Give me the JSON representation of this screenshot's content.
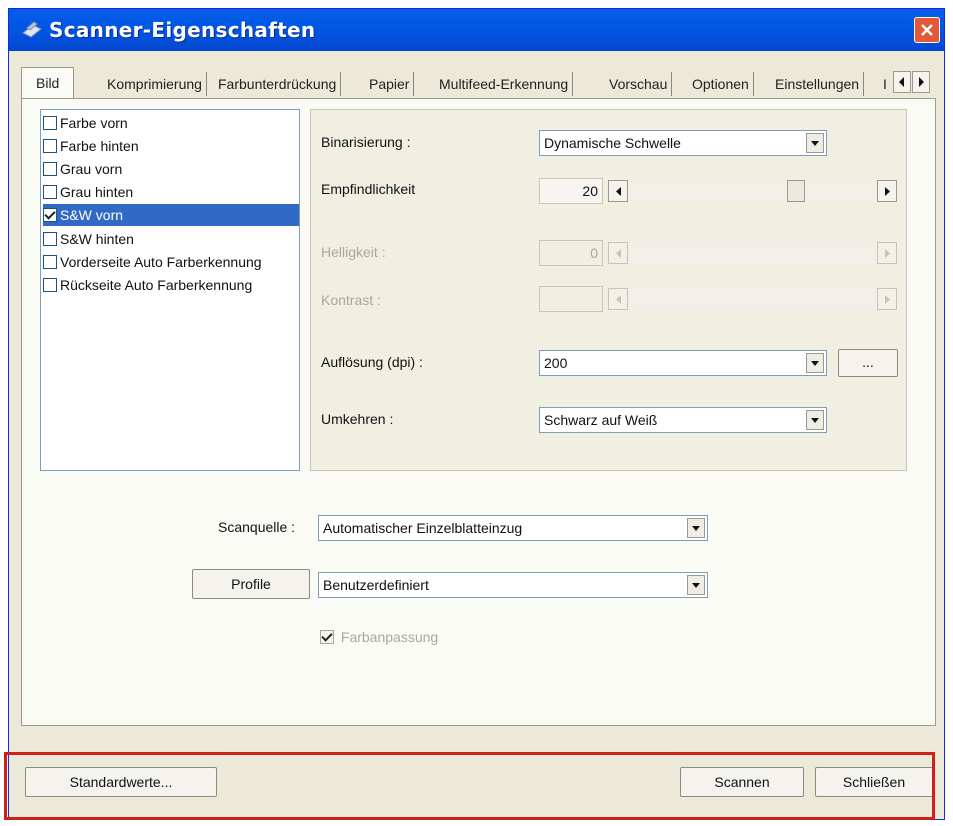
{
  "window": {
    "title": "Scanner-Eigenschaften"
  },
  "tabs": [
    {
      "label": "Bild"
    },
    {
      "label": "Komprimierung"
    },
    {
      "label": "Farbunterdrückung"
    },
    {
      "label": "Papier"
    },
    {
      "label": "Multifeed-Erkennung"
    },
    {
      "label": "Vorschau"
    },
    {
      "label": "Optionen"
    },
    {
      "label": "Einstellungen"
    },
    {
      "label": "I"
    }
  ],
  "image_list": [
    {
      "label": "Farbe vorn",
      "checked": false
    },
    {
      "label": "Farbe hinten",
      "checked": false
    },
    {
      "label": "Grau vorn",
      "checked": false
    },
    {
      "label": "Grau hinten",
      "checked": false
    },
    {
      "label": "S&W vorn",
      "checked": true,
      "selected": true
    },
    {
      "label": "S&W hinten",
      "checked": false
    },
    {
      "label": "Vorderseite Auto Farberkennung",
      "checked": false
    },
    {
      "label": "Rückseite Auto Farberkennung",
      "checked": false
    }
  ],
  "settings": {
    "binarization": {
      "label": "Binarisierung :",
      "value": "Dynamische Schwelle"
    },
    "sensitivity": {
      "label": "Empfindlichkeit",
      "value": "20"
    },
    "brightness": {
      "label": "Helligkeit :",
      "value": "0"
    },
    "contrast": {
      "label": "Kontrast :",
      "value": ""
    },
    "resolution": {
      "label": "Auflösung (dpi) :",
      "value": "200",
      "more_label": "..."
    },
    "invert": {
      "label": "Umkehren :",
      "value": "Schwarz auf Weiß"
    }
  },
  "scan_source": {
    "label": "Scanquelle :",
    "value": "Automatischer Einzelblatteinzug"
  },
  "profile": {
    "button_label": "Profile",
    "value": "Benutzerdefiniert"
  },
  "color_matching": {
    "label": "Farbanpassung",
    "checked": true,
    "disabled": true
  },
  "footer": {
    "defaults_label": "Standardwerte...",
    "scan_label": "Scannen",
    "close_label": "Schließen"
  },
  "colors": {
    "titlebar": "#0058e6",
    "selection": "#3169c6",
    "highlight_border": "#d0201c"
  }
}
